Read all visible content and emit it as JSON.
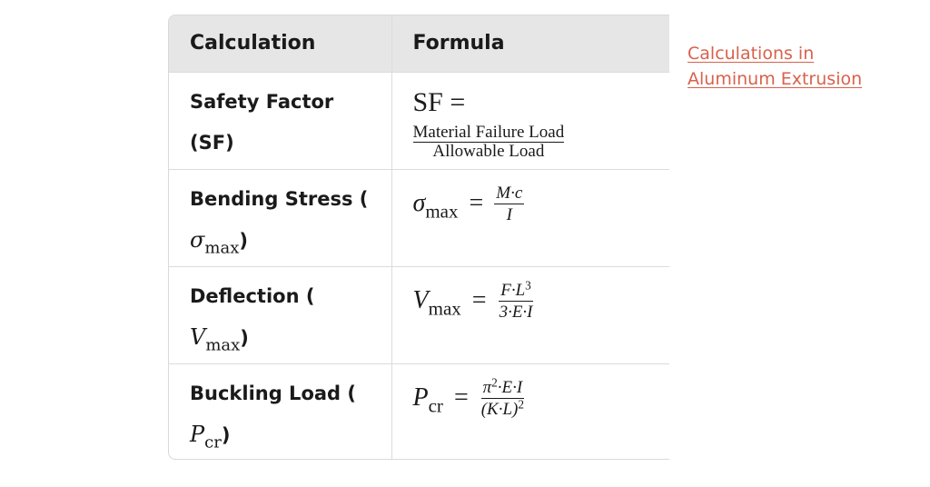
{
  "table": {
    "headers": [
      "Calculation",
      "Formula"
    ],
    "rows": [
      {
        "calc_text": "Safety Factor (SF)",
        "calc_symbol": "",
        "calc_symbol_sub": "",
        "formula": {
          "lhs": "SF",
          "eq": "=",
          "numerator": "Material Failure Load",
          "denominator": "Allowable Load"
        }
      },
      {
        "calc_text": "Bending Stress (",
        "calc_symbol": "σ",
        "calc_symbol_sub": "max",
        "calc_close": ")",
        "formula": {
          "lhs": "σ",
          "lhs_sub": "max",
          "eq": "=",
          "numerator": "M·c",
          "denominator": "I"
        }
      },
      {
        "calc_text": "Deflection (",
        "calc_symbol": "V",
        "calc_symbol_sub": "max",
        "calc_close": ")",
        "formula": {
          "lhs": "V",
          "lhs_sub": "max",
          "eq": "=",
          "numerator": "F·L",
          "numerator_sup": "3",
          "denominator": "3·E·I"
        }
      },
      {
        "calc_text": "Buckling Load (",
        "calc_symbol": "P",
        "calc_symbol_sub": "cr",
        "calc_close": ")",
        "formula": {
          "lhs": "P",
          "lhs_sub": "cr",
          "eq": "=",
          "numerator_pre": "π",
          "numerator_pre_sup": "2",
          "numerator": "·E·I",
          "denominator": "(K·L)",
          "denominator_sup": "2"
        }
      }
    ]
  },
  "side_link": {
    "label": "Calculations in Aluminum Extrusion",
    "color": "#d9614c"
  }
}
